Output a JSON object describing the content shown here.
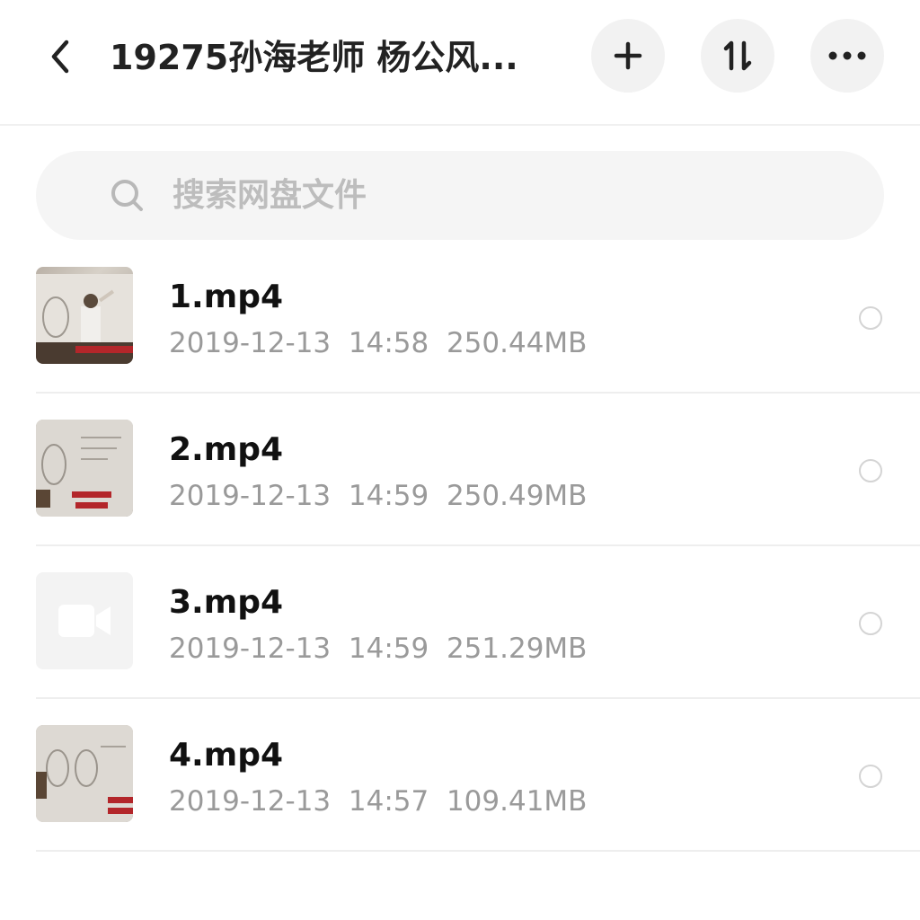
{
  "header": {
    "title": "19275孙海老师 杨公风..."
  },
  "search": {
    "placeholder": "搜索网盘文件",
    "value": ""
  },
  "files": [
    {
      "name": "1.mp4",
      "date": "2019-12-13",
      "time": "14:58",
      "size": "250.44MB",
      "thumbnail": "video-frame"
    },
    {
      "name": "2.mp4",
      "date": "2019-12-13",
      "time": "14:59",
      "size": "250.49MB",
      "thumbnail": "video-frame"
    },
    {
      "name": "3.mp4",
      "date": "2019-12-13",
      "time": "14:59",
      "size": "251.29MB",
      "thumbnail": "video-camera-icon"
    },
    {
      "name": "4.mp4",
      "date": "2019-12-13",
      "time": "14:57",
      "size": "109.41MB",
      "thumbnail": "video-frame"
    }
  ],
  "icons": {
    "back": "chevron-left-icon",
    "add": "plus-icon",
    "sort": "sort-icon",
    "more": "more-horizontal-icon",
    "search": "search-icon"
  },
  "colors": {
    "title": "#222222",
    "meta_text": "#9a9a9a",
    "button_bg": "#f2f2f2",
    "search_bg": "#f5f5f5",
    "placeholder": "#bdbdbd"
  }
}
